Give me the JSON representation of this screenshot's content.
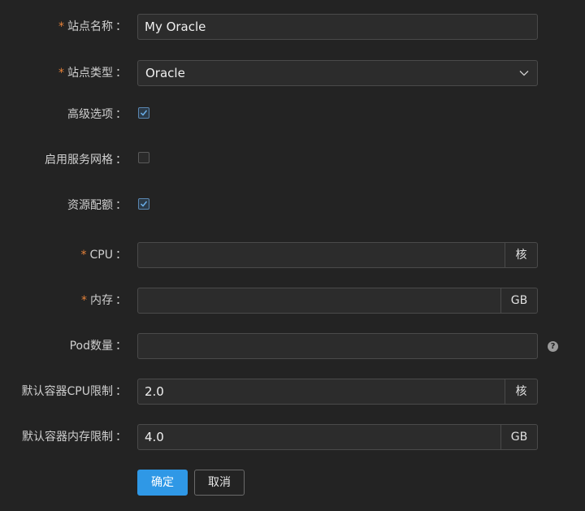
{
  "form": {
    "site_name": {
      "label": "站点名称",
      "value": "My Oracle",
      "required": true
    },
    "site_type": {
      "label": "站点类型",
      "value": "Oracle",
      "required": true
    },
    "advanced_options": {
      "label": "高级选项",
      "checked": true
    },
    "service_mesh": {
      "label": "启用服务网格",
      "checked": false
    },
    "resource_quota": {
      "label": "资源配额",
      "checked": true
    },
    "cpu": {
      "label": "CPU",
      "value": "",
      "unit": "核",
      "required": true
    },
    "memory": {
      "label": "内存",
      "value": "",
      "unit": "GB",
      "required": true
    },
    "pod_count": {
      "label": "Pod数量",
      "value": "",
      "help_icon": "?"
    },
    "default_cpu_limit": {
      "label": "默认容器CPU限制",
      "value": "2.0",
      "unit": "核"
    },
    "default_memory_limit": {
      "label": "默认容器内存限制",
      "value": "4.0",
      "unit": "GB"
    },
    "colon": "：",
    "required_mark": "*"
  },
  "actions": {
    "confirm_label": "确定",
    "cancel_label": "取消"
  },
  "colors": {
    "primary": "#2f98e6",
    "required": "#e6823a",
    "background": "#232323"
  },
  "icons": {
    "select_arrow": "chevron-down-icon",
    "checkbox_check": "check-icon",
    "help": "question-circle-icon"
  }
}
